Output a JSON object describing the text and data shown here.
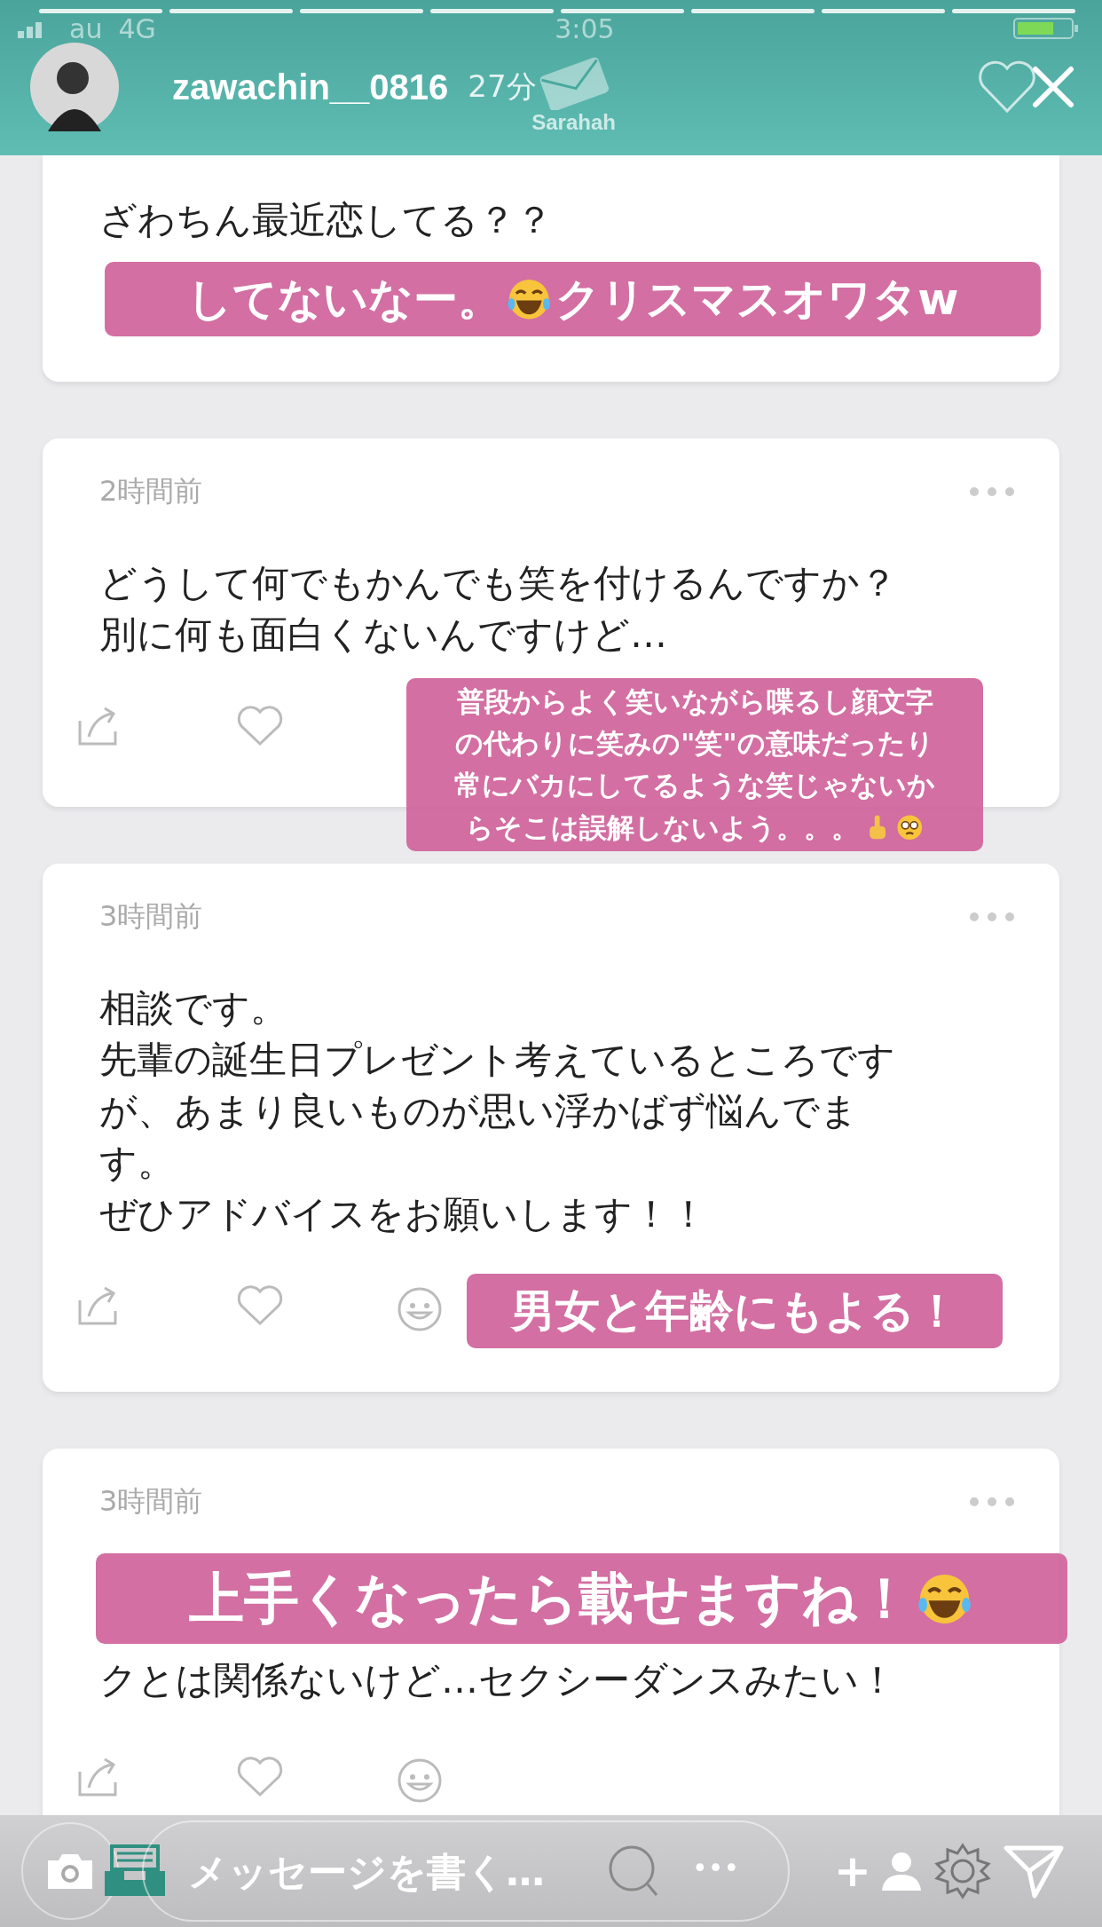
{
  "status_bar": {
    "carrier": "au",
    "network": "4G",
    "time": "3:05"
  },
  "story": {
    "username": "zawachin__0816",
    "age": "27分",
    "app_name": "Sarahah"
  },
  "cards": [
    {
      "lines": [
        "ざわちん最近恋してる？？"
      ],
      "actions": false,
      "sticker": {
        "lines": [
          [
            {
              "kind": "text",
              "text": "してないなー。"
            },
            {
              "kind": "laugh"
            },
            {
              "kind": "text",
              "text": "クリスマスオワタw"
            }
          ]
        ]
      }
    },
    {
      "time": "2時間前",
      "lines": [
        "どうして何でもかんでも笑を付けるんですか？",
        "別に何も面白くないんですけど…"
      ],
      "actions": true,
      "sticker": {
        "lines": [
          [
            {
              "kind": "text",
              "text": "普段からよく笑いながら喋るし顔文字"
            }
          ],
          [
            {
              "kind": "text",
              "text": "の代わりに笑みの\"笑\"の意味だったり"
            }
          ],
          [
            {
              "kind": "text",
              "text": "常にバカにしてるような笑じゃないか"
            }
          ],
          [
            {
              "kind": "text",
              "text": "らそこは誤解しないよう。。。"
            },
            {
              "kind": "point"
            },
            {
              "kind": "dizzy"
            }
          ]
        ]
      }
    },
    {
      "time": "3時間前",
      "lines": [
        "相談です。",
        "先輩の誕生日プレゼント考えているところです",
        "が、あまり良いものが思い浮かばず悩んでま",
        "す。",
        "ぜひアドバイスをお願いします！！"
      ],
      "actions": true,
      "sticker": {
        "lines": [
          [
            {
              "kind": "text",
              "text": "男女と年齢にもよる！"
            }
          ]
        ]
      }
    },
    {
      "time": "3時間前",
      "lines": [
        "クとは関係ないけど…セクシーダンスみたい！"
      ],
      "actions": true,
      "sticker": {
        "lines": [
          [
            {
              "kind": "text",
              "text": "上手くなったら載せますね！"
            },
            {
              "kind": "laugh"
            }
          ]
        ]
      }
    }
  ],
  "composer": {
    "placeholder": "メッセージを書く…",
    "more": "•••",
    "add": "+"
  }
}
